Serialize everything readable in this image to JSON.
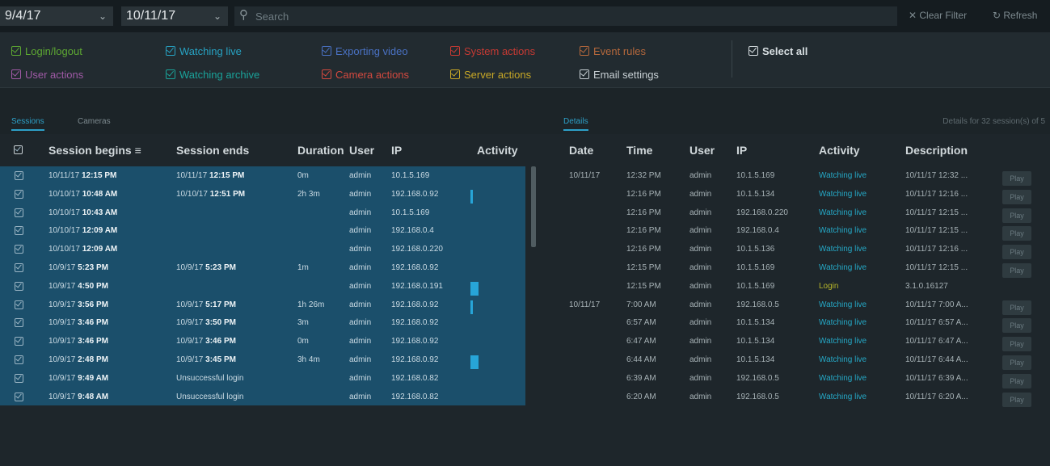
{
  "topbar": {
    "date_from": "9/4/17",
    "date_to": "10/11/17",
    "search_placeholder": "Search",
    "clear_filter": "Clear Filter",
    "refresh": "Refresh"
  },
  "filters": [
    {
      "label": "Login/logout",
      "color": "#5da832"
    },
    {
      "label": "User actions",
      "color": "#a05aa6"
    },
    {
      "label": "Watching live",
      "color": "#27a2c2"
    },
    {
      "label": "Watching archive",
      "color": "#1aa39a"
    },
    {
      "label": "Exporting video",
      "color": "#4a72c4"
    },
    {
      "label": "Camera actions",
      "color": "#d4493f"
    },
    {
      "label": "System actions",
      "color": "#c73a33"
    },
    {
      "label": "Server actions",
      "color": "#c9a826"
    },
    {
      "label": "Event rules",
      "color": "#b5683c"
    },
    {
      "label": "Email settings",
      "color": "#c8d0d4"
    },
    {
      "label": "Select all",
      "color": "#d8dfe2"
    }
  ],
  "tabs": {
    "sessions": "Sessions",
    "cameras": "Cameras",
    "details": "Details",
    "details_summary": "Details for 32 session(s) of 5"
  },
  "left_table": {
    "headers": [
      "Session begins",
      "Session ends",
      "Duration",
      "User",
      "IP",
      "Activity"
    ],
    "rows": [
      {
        "begin_date": "10/11/17",
        "begin_time": "12:15 PM",
        "end_date": "10/11/17",
        "end_time": "12:15 PM",
        "duration": "0m",
        "user": "admin",
        "ip": "10.1.5.169"
      },
      {
        "begin_date": "10/10/17",
        "begin_time": "10:48 AM",
        "end_date": "10/10/17",
        "end_time": "12:51 PM",
        "duration": "2h 3m",
        "user": "admin",
        "ip": "192.168.0.92"
      },
      {
        "begin_date": "10/10/17",
        "begin_time": "10:43 AM",
        "end_date": "",
        "end_time": "",
        "duration": "",
        "user": "admin",
        "ip": "10.1.5.169"
      },
      {
        "begin_date": "10/10/17",
        "begin_time": "12:09 AM",
        "end_date": "",
        "end_time": "",
        "duration": "",
        "user": "admin",
        "ip": "192.168.0.4"
      },
      {
        "begin_date": "10/10/17",
        "begin_time": "12:09 AM",
        "end_date": "",
        "end_time": "",
        "duration": "",
        "user": "admin",
        "ip": "192.168.0.220"
      },
      {
        "begin_date": "10/9/17",
        "begin_time": "5:23 PM",
        "end_date": "10/9/17",
        "end_time": "5:23 PM",
        "duration": "1m",
        "user": "admin",
        "ip": "192.168.0.92"
      },
      {
        "begin_date": "10/9/17",
        "begin_time": "4:50 PM",
        "end_date": "",
        "end_time": "",
        "duration": "",
        "user": "admin",
        "ip": "192.168.0.191"
      },
      {
        "begin_date": "10/9/17",
        "begin_time": "3:56 PM",
        "end_date": "10/9/17",
        "end_time": "5:17 PM",
        "duration": "1h 26m",
        "user": "admin",
        "ip": "192.168.0.92"
      },
      {
        "begin_date": "10/9/17",
        "begin_time": "3:46 PM",
        "end_date": "10/9/17",
        "end_time": "3:50 PM",
        "duration": "3m",
        "user": "admin",
        "ip": "192.168.0.92"
      },
      {
        "begin_date": "10/9/17",
        "begin_time": "3:46 PM",
        "end_date": "10/9/17",
        "end_time": "3:46 PM",
        "duration": "0m",
        "user": "admin",
        "ip": "192.168.0.92"
      },
      {
        "begin_date": "10/9/17",
        "begin_time": "2:48 PM",
        "end_date": "10/9/17",
        "end_time": "3:45 PM",
        "duration": "3h 4m",
        "user": "admin",
        "ip": "192.168.0.92"
      },
      {
        "begin_date": "10/9/17",
        "begin_time": "9:49 AM",
        "end_date": "Unsuccessful login",
        "end_time": "",
        "duration": "",
        "user": "admin",
        "ip": "192.168.0.82"
      },
      {
        "begin_date": "10/9/17",
        "begin_time": "9:48 AM",
        "end_date": "Unsuccessful login",
        "end_time": "",
        "duration": "",
        "user": "admin",
        "ip": "192.168.0.82"
      }
    ]
  },
  "right_table": {
    "headers": [
      "Date",
      "Time",
      "User",
      "IP",
      "Activity",
      "Description"
    ],
    "play_label": "Play",
    "rows": [
      {
        "date": "10/11/17",
        "time": "12:32 PM",
        "user": "admin",
        "ip": "10.1.5.169",
        "activity": "Watching live",
        "desc": "10/11/17 12:32 ..."
      },
      {
        "date": "",
        "time": "12:16 PM",
        "user": "admin",
        "ip": "10.1.5.134",
        "activity": "Watching live",
        "desc": "10/11/17 12:16 ..."
      },
      {
        "date": "",
        "time": "12:16 PM",
        "user": "admin",
        "ip": "192.168.0.220",
        "activity": "Watching live",
        "desc": "10/11/17 12:15 ..."
      },
      {
        "date": "",
        "time": "12:16 PM",
        "user": "admin",
        "ip": "192.168.0.4",
        "activity": "Watching live",
        "desc": "10/11/17 12:15 ..."
      },
      {
        "date": "",
        "time": "12:16 PM",
        "user": "admin",
        "ip": "10.1.5.136",
        "activity": "Watching live",
        "desc": "10/11/17 12:16 ..."
      },
      {
        "date": "",
        "time": "12:15 PM",
        "user": "admin",
        "ip": "10.1.5.169",
        "activity": "Watching live",
        "desc": "10/11/17 12:15 ..."
      },
      {
        "date": "",
        "time": "12:15 PM",
        "user": "admin",
        "ip": "10.1.5.169",
        "activity": "Login",
        "desc": "3.1.0.16127"
      },
      {
        "date": "10/11/17",
        "time": "7:00 AM",
        "user": "admin",
        "ip": "192.168.0.5",
        "activity": "Watching live",
        "desc": "10/11/17 7:00 A..."
      },
      {
        "date": "",
        "time": "6:57 AM",
        "user": "admin",
        "ip": "10.1.5.134",
        "activity": "Watching live",
        "desc": "10/11/17 6:57 A..."
      },
      {
        "date": "",
        "time": "6:47 AM",
        "user": "admin",
        "ip": "10.1.5.134",
        "activity": "Watching live",
        "desc": "10/11/17 6:47 A..."
      },
      {
        "date": "",
        "time": "6:44 AM",
        "user": "admin",
        "ip": "10.1.5.134",
        "activity": "Watching live",
        "desc": "10/11/17 6:44 A..."
      },
      {
        "date": "",
        "time": "6:39 AM",
        "user": "admin",
        "ip": "192.168.0.5",
        "activity": "Watching live",
        "desc": "10/11/17 6:39 A..."
      },
      {
        "date": "",
        "time": "6:20 AM",
        "user": "admin",
        "ip": "192.168.0.5",
        "activity": "Watching live",
        "desc": "10/11/17 6:20 A..."
      }
    ]
  }
}
